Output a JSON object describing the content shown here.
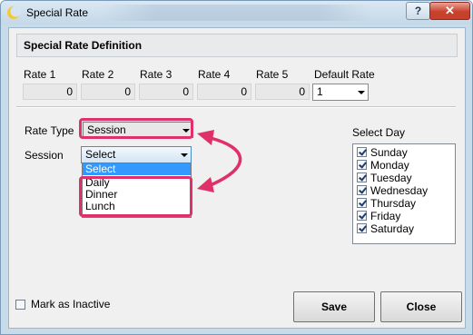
{
  "window": {
    "title": "Special Rate",
    "help_label": "?",
    "close_label": "✕"
  },
  "definition": {
    "title": "Special Rate Definition",
    "rates": [
      {
        "label": "Rate 1",
        "value": "0"
      },
      {
        "label": "Rate 2",
        "value": "0"
      },
      {
        "label": "Rate 3",
        "value": "0"
      },
      {
        "label": "Rate 4",
        "value": "0"
      },
      {
        "label": "Rate 5",
        "value": "0"
      }
    ],
    "default_rate": {
      "label": "Default Rate",
      "value": "1"
    }
  },
  "rate_type": {
    "label": "Rate Type",
    "value": "Session"
  },
  "session": {
    "label": "Session",
    "value": "Select",
    "options": [
      "Select",
      "Daily",
      "Dinner",
      "Lunch"
    ]
  },
  "select_day": {
    "label": "Select Day",
    "days": [
      {
        "label": "Sunday",
        "checked": true
      },
      {
        "label": "Monday",
        "checked": true
      },
      {
        "label": "Tuesday",
        "checked": true
      },
      {
        "label": "Wednesday",
        "checked": true
      },
      {
        "label": "Thursday",
        "checked": true
      },
      {
        "label": "Friday",
        "checked": true
      },
      {
        "label": "Saturday",
        "checked": true
      }
    ]
  },
  "inactive": {
    "label": "Mark as Inactive",
    "checked": false
  },
  "buttons": {
    "save": "Save",
    "close": "Close"
  },
  "colors": {
    "highlight": "#e0306a",
    "selection": "#3399ff"
  },
  "icons": {
    "app": "crescent-logo-icon",
    "help": "help-icon",
    "close": "close-icon",
    "arrow": "curved-arrow-icon"
  }
}
